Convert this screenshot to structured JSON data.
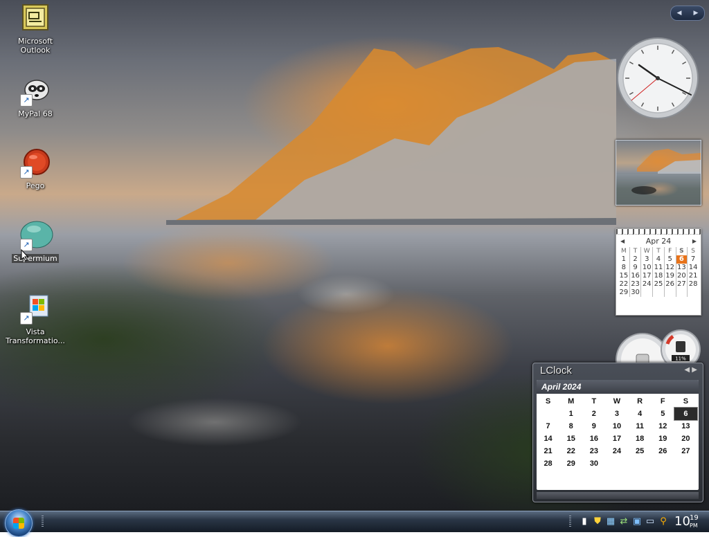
{
  "desktop": {
    "icons": [
      {
        "label": "Microsoft Outlook",
        "icon": "outlook-icon"
      },
      {
        "label": "MyPal 68",
        "icon": "mypal-raccoon-icon"
      },
      {
        "label": "Pego",
        "icon": "pego-red-ball-icon"
      },
      {
        "label": "Supermium",
        "icon": "supermium-teal-orb-icon"
      },
      {
        "label": "Vista Transformatio...",
        "icon": "vista-transformation-icon"
      }
    ]
  },
  "sidebar": {
    "nav_prev": "◀",
    "nav_next": "▶"
  },
  "mini_calendar": {
    "title": "Apr 24",
    "prev": "◀",
    "next": "▶",
    "weekdays": [
      "M",
      "T",
      "W",
      "T",
      "F",
      "S",
      "S"
    ],
    "weeks": [
      [
        "1",
        "2",
        "3",
        "4",
        "5",
        "6",
        "7"
      ],
      [
        "8",
        "9",
        "10",
        "11",
        "12",
        "13",
        "14"
      ],
      [
        "15",
        "16",
        "17",
        "18",
        "19",
        "20",
        "21"
      ],
      [
        "22",
        "23",
        "24",
        "25",
        "26",
        "27",
        "28"
      ],
      [
        "29",
        "30",
        "",
        "",
        "",
        "",
        ""
      ]
    ],
    "today": "6"
  },
  "meters": {
    "percent_label": "11%"
  },
  "lclock": {
    "title": "LClock",
    "month_label": "April  2024",
    "weekdays": [
      "S",
      "M",
      "T",
      "W",
      "R",
      "F",
      "S"
    ],
    "weeks": [
      [
        "",
        "1",
        "2",
        "3",
        "4",
        "5",
        "6"
      ],
      [
        "7",
        "8",
        "9",
        "10",
        "11",
        "12",
        "13"
      ],
      [
        "14",
        "15",
        "16",
        "17",
        "18",
        "19",
        "20"
      ],
      [
        "21",
        "22",
        "23",
        "24",
        "25",
        "26",
        "27"
      ],
      [
        "28",
        "29",
        "30",
        "",
        "",
        "",
        ""
      ]
    ],
    "today": "6"
  },
  "taskbar": {
    "clock_hour": "10",
    "clock_minute": "19",
    "clock_ampm": "PM",
    "tray_icons": [
      "speaker-icon",
      "shield-icon",
      "network-icon",
      "network-icon",
      "windows-update-icon",
      "monitor-icon",
      "search-icon"
    ]
  },
  "colors": {
    "today_highlight": "#e8731a",
    "lclock_today": "#2b2b2b",
    "taskbar": "#1e2733"
  }
}
